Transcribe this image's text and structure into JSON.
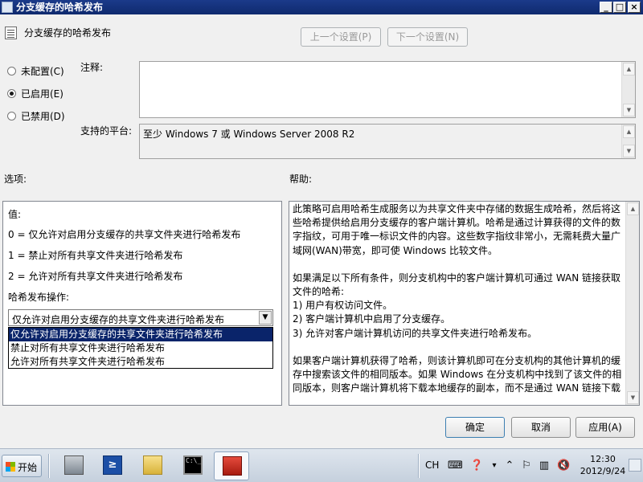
{
  "window": {
    "title": "分支缓存的哈希发布",
    "controls": {
      "minimize": "_",
      "maximize": "□",
      "close": "×"
    }
  },
  "header": {
    "icon": "policy-setting-icon",
    "title": "分支缓存的哈希发布",
    "prev_button": "上一个设置(P)",
    "next_button": "下一个设置(N)"
  },
  "state_options": [
    {
      "label": "未配置(C)",
      "selected": false
    },
    {
      "label": "已启用(E)",
      "selected": true
    },
    {
      "label": "已禁用(D)",
      "selected": false
    }
  ],
  "comment": {
    "label": "注释:",
    "value": ""
  },
  "platform": {
    "label": "支持的平台:",
    "value": "至少 Windows 7 或 Windows Server 2008 R2"
  },
  "sections": {
    "options_label": "选项:",
    "help_label": "帮助:"
  },
  "options_panel": {
    "value_label": "值:",
    "lines": [
      "0 = 仅允许对启用分支缓存的共享文件夹进行哈希发布",
      "1 = 禁止对所有共享文件夹进行哈希发布",
      "2 = 允许对所有共享文件夹进行哈希发布"
    ],
    "operation_label": "哈希发布操作:",
    "combo_value": "仅允许对启用分支缓存的共享文件夹进行哈希发布",
    "dropdown_items": [
      "仅允许对启用分支缓存的共享文件夹进行哈希发布",
      "禁止对所有共享文件夹进行哈希发布",
      "允许对所有共享文件夹进行哈希发布"
    ],
    "dropdown_selected_index": 0
  },
  "help_panel": {
    "paragraphs": [
      "此策略可启用哈希生成服务以为共享文件夹中存储的数据生成哈希，然后将这些哈希提供给启用分支缓存的客户端计算机。哈希是通过计算获得的文件的数字指纹，可用于唯一标识文件的内容。这些数字指纹非常小，无需耗费大量广域网(WAN)带宽，即可使 Windows 比较文件。",
      "如果满足以下所有条件，则分支机构中的客户端计算机可通过 WAN 链接获取文件的哈希:",
      "1) 用户有权访问文件。",
      "2) 客户端计算机中启用了分支缓存。",
      "3) 允许对客户端计算机访问的共享文件夹进行哈希发布。",
      "如果客户端计算机获得了哈希，则该计算机即可在分支机构的其他计算机的缓存中搜索该文件的相同版本。如果 Windows 在分支机构中找到了该文件的相同版本，则客户端计算机将下载本地缓存的副本，而不是通过 WAN 链接下载"
    ]
  },
  "footer": {
    "ok": "确定",
    "cancel": "取消",
    "apply": "应用(A)"
  },
  "taskbar": {
    "start_label": "开始",
    "apps": [
      {
        "icon": "server-manager-icon",
        "active": false
      },
      {
        "icon": "powershell-icon",
        "active": false,
        "glyph": "≥"
      },
      {
        "icon": "explorer-folder-icon",
        "active": false
      },
      {
        "icon": "command-prompt-icon",
        "active": false,
        "glyph": "C:\\_"
      },
      {
        "icon": "toolbox-icon",
        "active": true
      }
    ],
    "language": "CH",
    "clock_time": "12:30",
    "clock_date": "2012/9/24"
  }
}
